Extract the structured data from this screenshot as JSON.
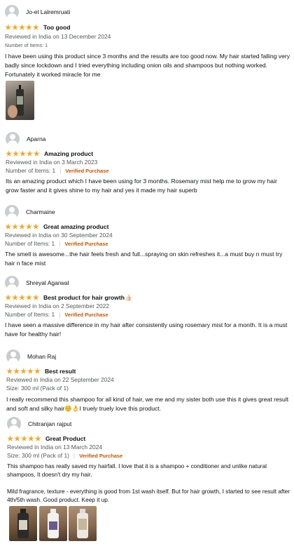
{
  "reviews": [
    {
      "user": "Jo-el Lalremruati",
      "title": "Too good",
      "reviewed": "Reviewed in India on 13 December 2024",
      "meta": "Number of Items: 1",
      "body": "I have been using this product since 3 months and the results are too good now. My hair started falling very badly since lockdown and I tried everything including onion oils and shampoos but nothing worked. Fortunately it worked miracle for me",
      "rating": 5
    },
    {
      "user": "Aparna",
      "title": "Amazing product",
      "reviewed": "Reviewed in India on 3 March 2023",
      "meta": "Number of Items: 1",
      "verified": "Verified Purchase",
      "body": "Its an amazing product which I have been using for 3 months. Rosemary mist help me to grow my hair grow faster and it gives shine to my hair and yes it made my hair superb",
      "rating": 5
    },
    {
      "user": "Charmaine",
      "title": "Great amazing product",
      "reviewed": "Reviewed in India on 30 September 2024",
      "meta": "Number of Items: 1",
      "verified": "Verified Purchase",
      "body": "The smell is awesome...the hair feels fresh and full...spraying on skin refreshes it...a must buy n must try hair n face mist",
      "rating": 5
    },
    {
      "user": "Shreyal Agarwal",
      "title": "Best product for hair growth👍🏻",
      "reviewed": "Reviewed in India on 2 September 2022",
      "meta": "Number of Items: 1",
      "verified": "Verified Purchase",
      "body": "I have seen a massive difference in my hair after consistently using rosemary mist for a month. It is a must have for healthy hair!",
      "rating": 5
    },
    {
      "user": "Mohan Raj",
      "title": "Best result",
      "reviewed": "Reviewed in India on 22 September 2024",
      "meta": "Size: 300 ml (Pack of 1)",
      "body": "I really recommend this shampoo for all kind of hair, we me and my sister both use this it gives great result and soft and silky hair☺️👌I truely truely love this product.",
      "rating": 5
    },
    {
      "user": "Chitranjan rajput",
      "title": "Great Product",
      "reviewed": "Reviewed in India on 13 March 2024",
      "meta": "Size: 300 ml (Pack of 1)",
      "verified": "Verified Purchase",
      "body": "This shampoo has really saved my hairfall. I love that it is a shampoo + conditioner and unlike natural shampoos, It doesn't dry my hair.",
      "body2": "Mild fragrance, texture - everything is good from 1st wash itself. But for hair growth, I started to see result after 4th/5th wash. Good product. Keep it up.",
      "rating": 5
    }
  ],
  "colors": {
    "star": "#f5a623",
    "verified": "#c45500",
    "meta": "#565959",
    "text": "#0f1111"
  },
  "icons": [
    "avatar-icon",
    "star-icon"
  ]
}
